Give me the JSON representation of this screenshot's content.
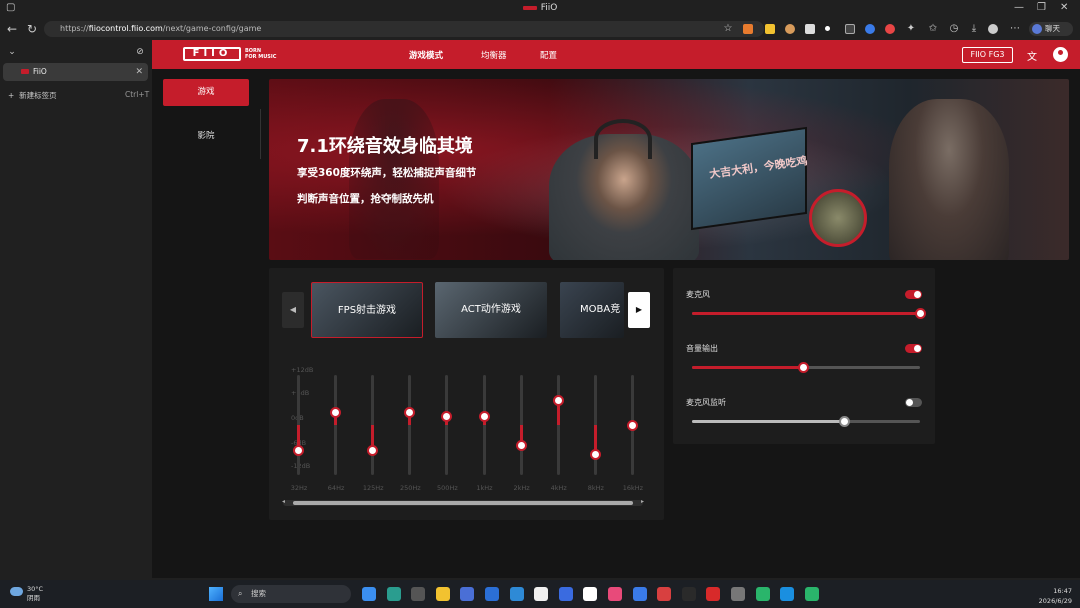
{
  "browser": {
    "window_title": "FiiO",
    "url_prefix": "https://",
    "url_host": "fiiocontrol.fiio.com",
    "url_path": "/next/game-config/game",
    "profile_label": "聊天"
  },
  "sidebar": {
    "tab_label": "FiiO",
    "new_tab_label": "新建标签页",
    "new_tab_shortcut": "Ctrl+T"
  },
  "app": {
    "logo_text": "FIIO",
    "tagline_line1": "BORN",
    "tagline_line2": "FOR MUSIC",
    "nav": [
      "游戏模式",
      "均衡器",
      "配置"
    ],
    "device": "FIIO FG3",
    "modes": [
      "游戏",
      "影院"
    ]
  },
  "banner": {
    "title": "7.1环绕音效身临其境",
    "subtitle1": "享受360度环绕声，轻松捕捉声音细节",
    "subtitle2": "判断声音位置，抢夺制敌先机",
    "monitor_text": "大吉大利，今晚吃鸡"
  },
  "eq": {
    "presets": [
      {
        "label": "FPS射击游戏",
        "active": true,
        "color": "#4a5560"
      },
      {
        "label": "ACT动作游戏",
        "active": false,
        "color": "#5a6670"
      },
      {
        "label": "MOBA竞",
        "active": false,
        "color": "#3a4450"
      }
    ],
    "db_labels": [
      "+12dB",
      "+6dB",
      "0dB",
      "-6dB",
      "-12dB"
    ],
    "bands": [
      {
        "freq": "32Hz",
        "gain": -6
      },
      {
        "freq": "64Hz",
        "gain": 3
      },
      {
        "freq": "125Hz",
        "gain": -6
      },
      {
        "freq": "250Hz",
        "gain": 3
      },
      {
        "freq": "500Hz",
        "gain": 2
      },
      {
        "freq": "1kHz",
        "gain": 2
      },
      {
        "freq": "2kHz",
        "gain": -5
      },
      {
        "freq": "4kHz",
        "gain": 6
      },
      {
        "freq": "8kHz",
        "gain": -7
      },
      {
        "freq": "16kHz",
        "gain": 0
      }
    ]
  },
  "controls": [
    {
      "label": "麦克风",
      "toggle": true,
      "level": 1.0
    },
    {
      "label": "音量输出",
      "toggle": true,
      "level": 0.49
    },
    {
      "label": "麦克风监听",
      "toggle": false,
      "level": 0.67
    }
  ],
  "taskbar": {
    "temperature": "30°C",
    "weather": "阴雨",
    "search_placeholder": "搜索",
    "time": "16:47",
    "date": "2026/6/29"
  },
  "colors": {
    "accent": "#c51d2b",
    "page_bg": "#151515",
    "panel_bg": "#1d1d1d"
  }
}
